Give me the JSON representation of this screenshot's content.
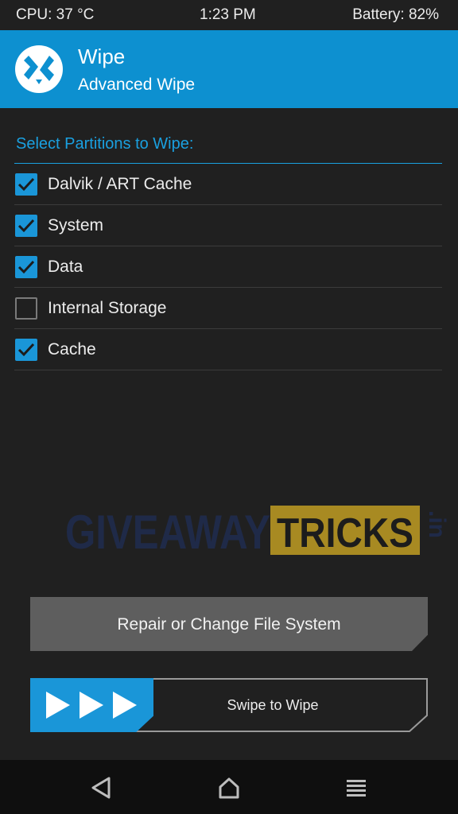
{
  "status": {
    "cpu": "CPU: 37 °C",
    "time": "1:23 PM",
    "battery": "Battery: 82%"
  },
  "header": {
    "title": "Wipe",
    "subtitle": "Advanced Wipe",
    "logo_icon": "twrp-logo-icon",
    "color": "#0d90d0"
  },
  "section": {
    "label": "Select Partitions to Wipe:"
  },
  "partitions": [
    {
      "label": "Dalvik / ART Cache",
      "checked": true
    },
    {
      "label": "System",
      "checked": true
    },
    {
      "label": "Data",
      "checked": true
    },
    {
      "label": "Internal Storage",
      "checked": false
    },
    {
      "label": "Cache",
      "checked": true
    }
  ],
  "watermark": {
    "text1": "GIVEAWAY",
    "text2": "TRICKS",
    "text3": ".in"
  },
  "buttons": {
    "repair_label": "Repair or Change File System",
    "swipe_label": "Swipe to Wipe"
  },
  "navbar": {
    "back_icon": "back-triangle-icon",
    "home_icon": "home-icon",
    "menu_icon": "menu-icon"
  },
  "colors": {
    "accent": "#1a96d8",
    "background": "#202020"
  }
}
